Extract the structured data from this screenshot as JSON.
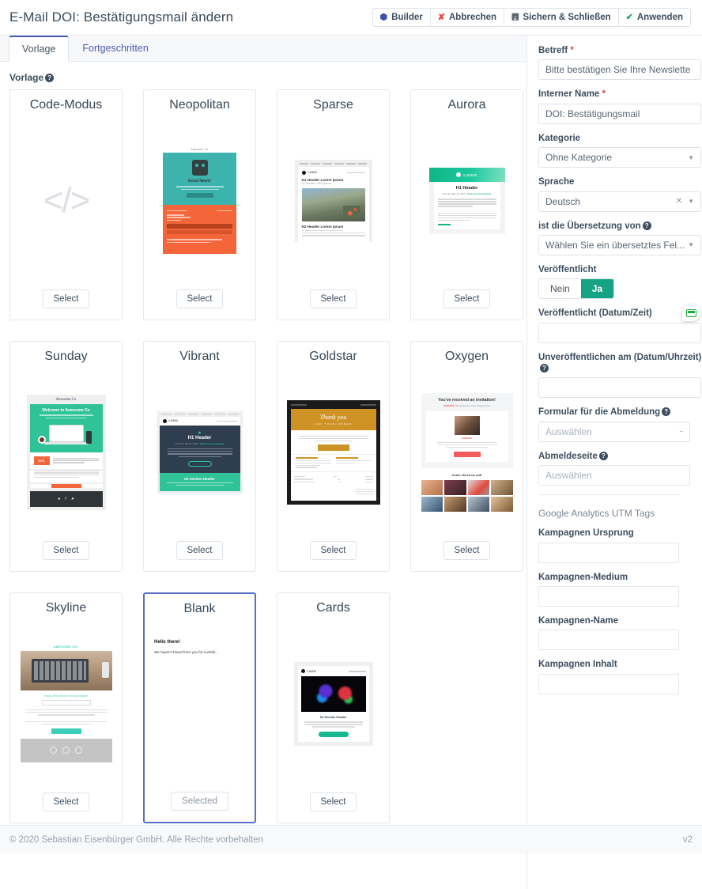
{
  "header": {
    "title": "E-Mail DOI: Bestätigungsmail ändern",
    "buttons": [
      {
        "label": "Builder",
        "icon": "builder-icon",
        "glyph": "⬢"
      },
      {
        "label": "Abbrechen",
        "icon": "close-icon",
        "glyph": "✖"
      },
      {
        "label": "Sichern & Schließen",
        "icon": "save-icon",
        "glyph": "💾"
      },
      {
        "label": "Anwenden",
        "icon": "check-icon",
        "glyph": "✔"
      }
    ]
  },
  "tabs": [
    {
      "label": "Vorlage",
      "active": true
    },
    {
      "label": "Fortgeschritten",
      "active": false
    }
  ],
  "section": {
    "label": "Vorlage",
    "help": "?"
  },
  "templates": [
    {
      "name": "Code-Modus",
      "button": "Select",
      "selected": false,
      "thumb": "code"
    },
    {
      "name": "Neopolitan",
      "button": "Select",
      "selected": false,
      "thumb": "neopolitan",
      "preview": {
        "brand": "Awesome Co",
        "heading": "Good News!"
      }
    },
    {
      "name": "Sparse",
      "button": "Select",
      "selected": false,
      "thumb": "sparse",
      "preview": {
        "logo": "LOGO",
        "h1": "H1 Header Lorem Ipsum",
        "h2": "H2 Subtitle Lorem Ipsum",
        "h2b": "H2 Header Lorem Ipsum"
      }
    },
    {
      "name": "Aurora",
      "button": "Select",
      "selected": false,
      "thumb": "aurora",
      "preview": {
        "logo": "LOGO",
        "h1": "H1 Header"
      }
    },
    {
      "name": "Sunday",
      "button": "Select",
      "selected": false,
      "thumb": "sunday",
      "preview": {
        "brand": "Awesome Co",
        "heading": "Welcome to Awesome Co",
        "tag": "50%"
      }
    },
    {
      "name": "Vibrant",
      "button": "Select",
      "selected": false,
      "thumb": "vibrant",
      "preview": {
        "logo": "LOGO",
        "h1": "H1 Header",
        "h2": "H2 Section Header"
      }
    },
    {
      "name": "Goldstar",
      "button": "Select",
      "selected": false,
      "thumb": "goldstar",
      "preview": {
        "h1": "Thank you",
        "sub": "FOR YOUR ORDER"
      }
    },
    {
      "name": "Oxygen",
      "button": "Select",
      "selected": false,
      "thumb": "oxygen",
      "preview": {
        "h1": "You've received an invitation!",
        "h2": "Come check us out!"
      }
    },
    {
      "name": "Skyline",
      "button": "Select",
      "selected": false,
      "thumb": "skyline",
      "preview": {
        "brand": "AWESOME INC"
      }
    },
    {
      "name": "Blank",
      "button": "Selected",
      "selected": true,
      "thumb": "blank",
      "preview": {
        "h1": "Hello there!",
        "p": "We haven't heard from you for a while..."
      }
    },
    {
      "name": "Cards",
      "button": "Select",
      "selected": false,
      "thumb": "cards",
      "preview": {
        "logo": "LOGO",
        "h2": "H2 Section Header"
      }
    }
  ],
  "form": {
    "subject": {
      "label": "Betreff",
      "required": "*",
      "value": "Bitte bestätigen Sie Ihre Newslette"
    },
    "internal_name": {
      "label": "Interner Name",
      "required": "*",
      "value": "DOI: Bestätigungsmail"
    },
    "category": {
      "label": "Kategorie",
      "value": "Ohne Kategorie"
    },
    "language": {
      "label": "Sprache",
      "value": "Deutsch",
      "clear": "✕"
    },
    "translation_of": {
      "label": "ist die Übersetzung von",
      "value": "Wählen Sie ein übersetztes Fel..."
    },
    "published": {
      "label": "Veröffentlicht",
      "no": "Nein",
      "yes": "Ja",
      "active": "yes"
    },
    "published_date": {
      "label": "Veröffentlicht (Datum/Zeit)",
      "value": ""
    },
    "unpublished_date": {
      "label": "Unveröffentlichen am (Datum/Uhrzeit)",
      "value": ""
    },
    "unsub_form": {
      "label": "Formular für die Abmeldung",
      "placeholder": "Auswählen"
    },
    "unsub_page": {
      "label": "Abmeldeseite",
      "placeholder": "Auswählen"
    },
    "utm": {
      "title": "Google Analytics UTM Tags",
      "source": {
        "label": "Kampagnen Ursprung",
        "value": ""
      },
      "medium": {
        "label": "Kampagnen-Medium",
        "value": ""
      },
      "name": {
        "label": "Kampagnen-Name",
        "value": ""
      },
      "content": {
        "label": "Kampagnen Inhalt",
        "value": ""
      }
    }
  },
  "footer": {
    "copyright": "© 2020 Sebastian Eisenbürger GmbH. Alle Rechte vorbehalten",
    "version": "v2"
  },
  "colors": {
    "accent_green": "#17a383",
    "accent_blue": "#4a5bb5",
    "danger": "#e8453c",
    "border": "#e4e7ec"
  }
}
